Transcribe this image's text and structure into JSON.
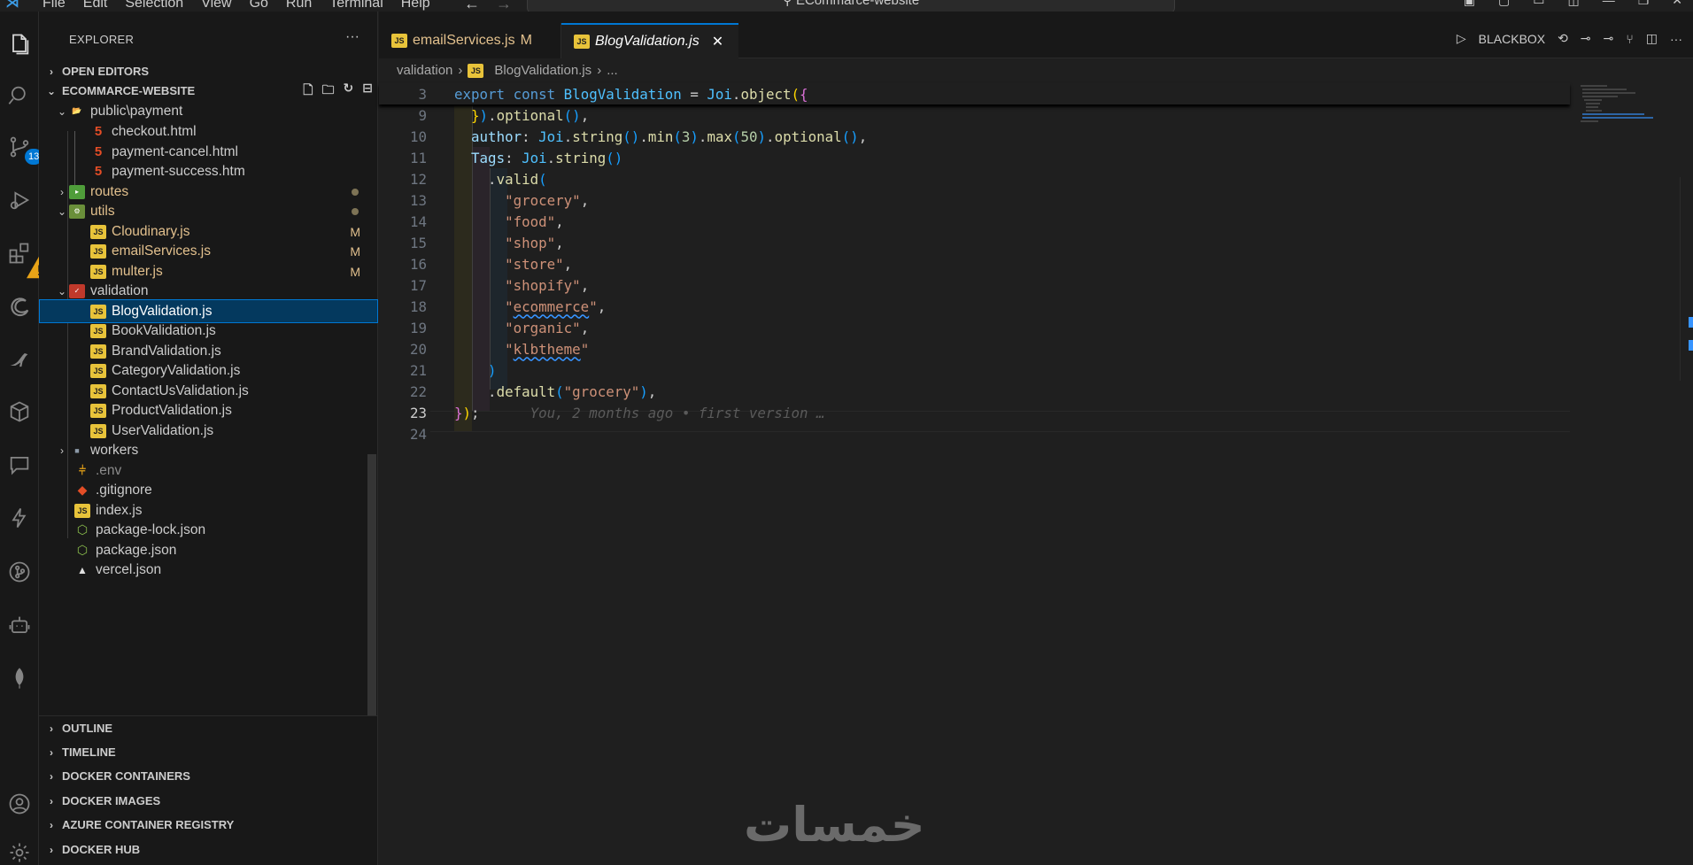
{
  "titlebar": {
    "menu": [
      "File",
      "Edit",
      "Selection",
      "View",
      "Go",
      "Run",
      "Terminal",
      "Help"
    ],
    "search_text": "ECommarce-website"
  },
  "activity": {
    "source_control_badge": "13"
  },
  "sidebar": {
    "title": "EXPLORER",
    "open_editors": "OPEN EDITORS",
    "project": "ECOMMARCE-WEBSITE",
    "tree": {
      "public_payment": "public\\payment",
      "checkout": "checkout.html",
      "payment_cancel": "payment-cancel.html",
      "payment_success": "payment-success.htm",
      "routes": "routes",
      "utils": "utils",
      "cloudinary": "Cloudinary.js",
      "emailservices": "emailServices.js",
      "multer": "multer.js",
      "validation": "validation",
      "blog": "BlogValidation.js",
      "book": "BookValidation.js",
      "brand": "BrandValidation.js",
      "category": "CategoryValidation.js",
      "contactus": "ContactUsValidation.js",
      "product": "ProductValidation.js",
      "user": "UserValidation.js",
      "workers": "workers",
      "env": ".env",
      "gitignore": ".gitignore",
      "index": "index.js",
      "package_lock": "package-lock.json",
      "package": "package.json",
      "vercel": "vercel.json",
      "modified_marker": "M"
    },
    "sections": {
      "outline": "OUTLINE",
      "timeline": "TIMELINE",
      "docker_containers": "DOCKER CONTAINERS",
      "docker_images": "DOCKER IMAGES",
      "azure": "AZURE CONTAINER REGISTRY",
      "docker_hub": "DOCKER HUB"
    }
  },
  "tabs": {
    "tab1": "emailServices.js",
    "tab1_status": "M",
    "tab2": "BlogValidation.js",
    "blackbox": "BLACKBOX"
  },
  "breadcrumb": {
    "folder": "validation",
    "file": "BlogValidation.js",
    "more": "..."
  },
  "editor": {
    "line_numbers": [
      "3",
      "9",
      "10",
      "11",
      "12",
      "13",
      "14",
      "15",
      "16",
      "17",
      "18",
      "19",
      "20",
      "21",
      "22",
      "23",
      "24"
    ],
    "blame": "You, 2 months ago • first version …"
  },
  "watermark": "خمسات"
}
